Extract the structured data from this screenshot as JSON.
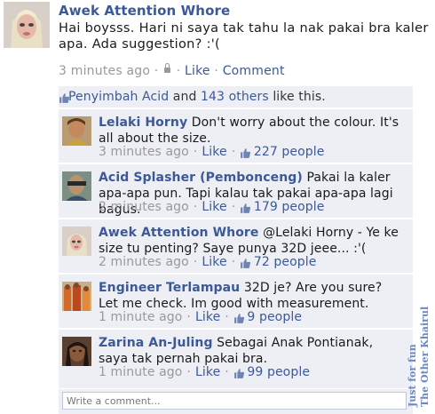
{
  "post": {
    "author": "Awek Attention Whore",
    "text": "Hai boysss. Hari ni saya tak tahu la nak pakai bra kaler apa. Ada suggestion? :'(",
    "time": "3 minutes ago",
    "sep1": " · ",
    "sep2": " · ",
    "like_label": "Like",
    "comment_label": "Comment"
  },
  "likes": {
    "first_name": "Penyimbah Acid",
    "and_text": " and ",
    "others_link": "143 others",
    "suffix": " like this."
  },
  "comments": [
    {
      "author": "Lelaki Horny",
      "text": "Don't worry about the colour. It's all about the size.",
      "time": "3 minutes ago",
      "like_label": "Like",
      "likes_count": "227 people"
    },
    {
      "author": "Acid Splasher (Pembonceng)",
      "text": "Pakai la kaler apa-apa pun. Tapi kalau tak pakai apa-apa lagi bagus.",
      "time": "2 minutes ago",
      "like_label": "Like",
      "likes_count": "179 people"
    },
    {
      "author": "Awek Attention Whore",
      "text": "@Lelaki Horny - Ye ke size tu penting? Saye punya 32D jeee... :'(",
      "time": "2 minutes ago",
      "like_label": "Like",
      "likes_count": "72 people"
    },
    {
      "author": "Engineer Terlampau",
      "text": "32D je? Are you sure? Let me check. Im good with measurement.",
      "time": "1 minute ago",
      "like_label": "Like",
      "likes_count": "9 people"
    },
    {
      "author": "Zarina An-Juling",
      "text": "Sebagai Anak Pontianak, saya tak pernah pakai bra.",
      "time": "1 minute ago",
      "like_label": "Like",
      "likes_count": "99 people"
    }
  ],
  "write": {
    "placeholder": "Write a comment..."
  },
  "watermark": {
    "line1": "Just for fun",
    "line2": "The Other Khairul"
  },
  "colors": {
    "link": "#3b5998",
    "meta": "#999999",
    "panel": "#edeff4"
  }
}
